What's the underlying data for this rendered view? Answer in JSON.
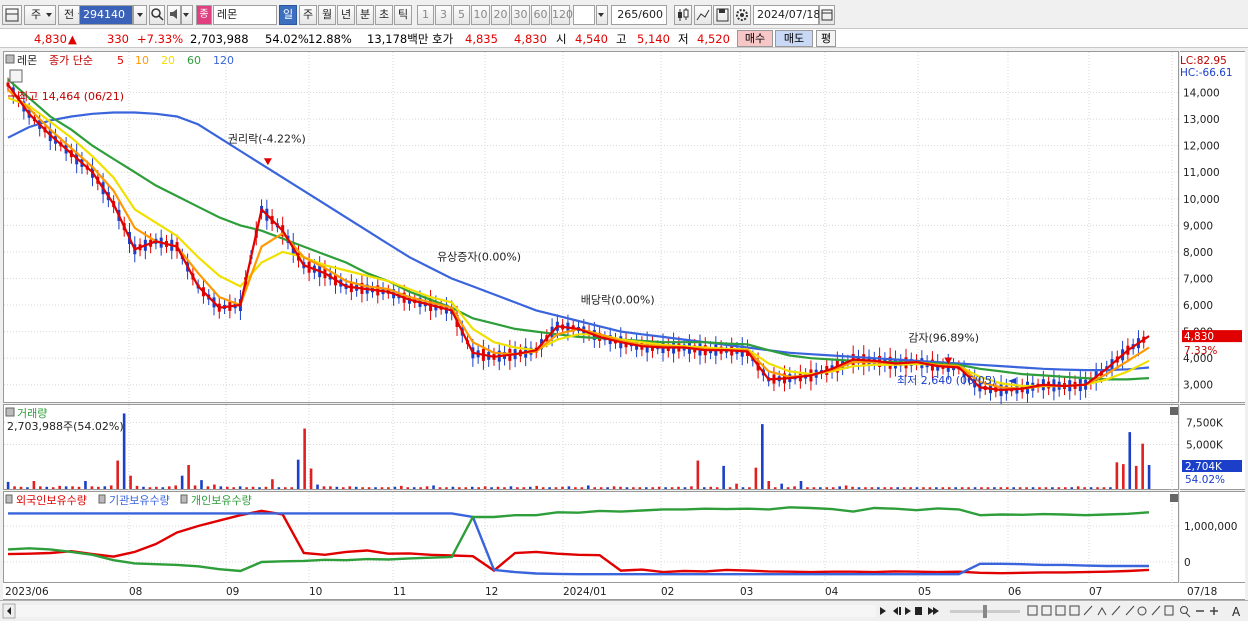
{
  "toolbar": {
    "market": "주",
    "prev": "전",
    "code": "294140",
    "name": "레몬",
    "periods": [
      "일",
      "주",
      "월",
      "년",
      "분",
      "초",
      "틱"
    ],
    "intervals": [
      "1",
      "3",
      "5",
      "10",
      "20",
      "30",
      "60",
      "120"
    ],
    "count": "265",
    "count_max": "/600",
    "date": "2024/07/18"
  },
  "quote": {
    "price": "4,830",
    "change": "330",
    "change_pct": "+7.33%",
    "volume": "2,703,988",
    "vol_ratio": "54.02%",
    "turnover": "12.88%",
    "amount": "13,178백만",
    "bid_label": "호가",
    "ask": "4,835",
    "bid": "4,830",
    "open_label": "시",
    "open": "4,540",
    "high_label": "고",
    "high": "5,140",
    "low_label": "저",
    "low": "4,520",
    "buy_btn": "매수",
    "sell_btn": "매도",
    "eval_btn": "평"
  },
  "price_panel": {
    "name": "레몬",
    "legend_prefix": "종가 단순",
    "ma_labels": [
      "5",
      "10",
      "20",
      "60",
      "120"
    ],
    "ma_colors": [
      "#e00000",
      "#ff9900",
      "#f0e000",
      "#2e9e3a",
      "#3a64dc"
    ],
    "lc": "LC:82.95",
    "hc": "HC:-66.61",
    "cur_price": "4,830",
    "cur_pct": "7.33%",
    "high_note": "최고 14,464 (06/21)",
    "low_note": "최저 2,640 (06/05)",
    "events": [
      "권리락(-4.22%)",
      "유상증자(0.00%)",
      "배당락(0.00%)",
      "감자(96.89%)"
    ]
  },
  "volume_panel": {
    "title": "거래량",
    "value": "2,703,988주(54.02%)",
    "cur": "2,704K",
    "cur_pct": "54.02%"
  },
  "holding_panel": {
    "series": [
      "외국인보유수량",
      "기관보유수량",
      "개인보유수량"
    ],
    "colors": [
      "#e00000",
      "#3a64dc",
      "#2e9e3a"
    ]
  },
  "x_labels": [
    "2023/06",
    "08",
    "09",
    "10",
    "11",
    "12",
    "2024/01",
    "02",
    "03",
    "04",
    "05",
    "06",
    "07",
    "07/18"
  ],
  "chart_data": [
    {
      "type": "line",
      "title": "",
      "y_ticks": [
        "14,000",
        "13,000",
        "12,000",
        "11,000",
        "10,000",
        "9,000",
        "8,000",
        "7,000",
        "6,000",
        "5,000",
        "4,000",
        "3,000"
      ],
      "ylim": [
        2500,
        15000
      ],
      "series": [
        {
          "name": "5",
          "values": [
            14300,
            13200,
            12400,
            11700,
            11000,
            9800,
            8100,
            8400,
            8200,
            6700,
            5900,
            6000,
            9600,
            8800,
            7500,
            7200,
            6700,
            6600,
            6500,
            6200,
            6000,
            5800,
            4200,
            4050,
            4150,
            4300,
            5200,
            5100,
            4800,
            4600,
            4450,
            4400,
            4400,
            4300,
            4300,
            4250,
            3200,
            3250,
            3350,
            3600,
            3950,
            3900,
            3800,
            3850,
            3700,
            3650,
            2900,
            2800,
            2850,
            3000,
            2950,
            3000,
            3600,
            4300,
            4830
          ]
        },
        {
          "name": "10",
          "values": [
            14100,
            13400,
            12600,
            11900,
            11200,
            10300,
            8900,
            8400,
            8200,
            7200,
            6300,
            6000,
            8200,
            8700,
            7800,
            7400,
            6900,
            6700,
            6600,
            6300,
            6100,
            5900,
            4600,
            4200,
            4150,
            4250,
            4900,
            5100,
            4900,
            4650,
            4500,
            4450,
            4400,
            4350,
            4300,
            4300,
            3500,
            3300,
            3350,
            3550,
            3850,
            3850,
            3800,
            3850,
            3750,
            3700,
            3100,
            2900,
            2850,
            2950,
            2950,
            3000,
            3400,
            3900,
            4400
          ]
        },
        {
          "name": "20",
          "values": [
            13800,
            13500,
            12900,
            12300,
            11600,
            10800,
            9600,
            9100,
            8600,
            7800,
            7100,
            6700,
            7600,
            8000,
            7800,
            7500,
            7300,
            7100,
            6900,
            6600,
            6300,
            6100,
            5100,
            4600,
            4400,
            4300,
            4700,
            4900,
            4900,
            4700,
            4600,
            4500,
            4450,
            4400,
            4350,
            4330,
            3800,
            3500,
            3400,
            3500,
            3700,
            3750,
            3750,
            3780,
            3750,
            3700,
            3300,
            3050,
            2950,
            2950,
            2950,
            3000,
            3200,
            3500,
            3900
          ]
        },
        {
          "name": "60",
          "values": [
            14500,
            13800,
            13100,
            12600,
            12000,
            11500,
            11000,
            10500,
            10100,
            9700,
            9300,
            9000,
            8800,
            8500,
            8200,
            7900,
            7600,
            7200,
            6900,
            6500,
            6200,
            5900,
            5500,
            5300,
            5100,
            5000,
            4900,
            4800,
            4750,
            4700,
            4650,
            4600,
            4600,
            4600,
            4550,
            4520,
            4300,
            4100,
            4000,
            3950,
            3900,
            3870,
            3850,
            3830,
            3800,
            3750,
            3600,
            3500,
            3400,
            3350,
            3300,
            3250,
            3200,
            3200,
            3250
          ]
        },
        {
          "name": "120",
          "values": [
            12300,
            12700,
            12950,
            13100,
            13200,
            13250,
            13250,
            13200,
            13100,
            12800,
            12300,
            11800,
            11300,
            10800,
            10300,
            9800,
            9300,
            8800,
            8300,
            7800,
            7400,
            7000,
            6700,
            6400,
            6100,
            5800,
            5600,
            5400,
            5200,
            5000,
            4900,
            4800,
            4700,
            4600,
            4500,
            4400,
            4300,
            4200,
            4150,
            4100,
            4050,
            4000,
            3950,
            3900,
            3850,
            3800,
            3750,
            3700,
            3650,
            3600,
            3570,
            3550,
            3550,
            3580,
            3650
          ]
        }
      ]
    },
    {
      "type": "bar",
      "title": "거래량",
      "y_ticks": [
        "7,500K",
        "5,000K"
      ],
      "ylim": [
        0,
        9000
      ],
      "values": [
        800,
        300,
        250,
        200,
        900,
        300,
        250,
        200,
        350,
        300,
        300,
        250,
        900,
        300,
        250,
        300,
        400,
        3200,
        8500,
        1500,
        350,
        250,
        200,
        250,
        200,
        300,
        400,
        1500,
        2700,
        400,
        1000,
        300,
        500,
        300,
        250,
        200,
        300,
        200,
        250,
        200,
        250,
        1100,
        200,
        200,
        200,
        3300,
        6800,
        2300,
        500,
        300,
        300,
        250,
        200,
        300,
        250,
        200,
        200,
        200,
        200,
        200,
        250,
        350,
        200,
        200,
        200,
        300,
        400,
        200,
        200,
        250,
        200,
        200,
        250,
        200,
        300,
        200,
        250,
        200,
        300,
        200,
        200,
        250,
        350,
        200,
        200,
        200,
        250,
        300,
        200,
        200,
        400,
        200,
        200,
        200,
        300,
        250,
        200,
        200,
        200,
        200,
        200,
        250,
        200,
        200,
        250,
        200,
        300,
        3200,
        200,
        250,
        200,
        2600,
        200,
        600,
        200,
        200,
        2400,
        7300,
        900,
        200,
        600,
        200,
        300,
        900,
        200,
        200,
        200,
        200,
        200,
        300,
        400,
        250,
        200,
        200,
        200,
        200,
        200,
        200,
        200,
        200,
        200,
        200,
        200,
        200,
        200,
        200,
        200,
        200,
        200,
        200,
        200,
        200,
        200,
        200,
        200,
        200,
        200,
        200,
        200,
        200,
        200,
        200,
        200,
        200,
        200,
        200,
        300,
        200,
        200,
        200,
        200,
        200,
        3000,
        2800,
        6400,
        2600,
        5100,
        2700
      ]
    },
    {
      "type": "line",
      "title": "",
      "y_ticks": [
        "1,000,000",
        "0"
      ],
      "ylim": [
        -500000,
        1500000
      ],
      "series": [
        {
          "name": "외국인보유수량",
          "values": [
            220000,
            230000,
            250000,
            300000,
            220000,
            150000,
            280000,
            500000,
            820000,
            1000000,
            1150000,
            1300000,
            1420000,
            1320000,
            250000,
            200000,
            280000,
            320000,
            230000,
            240000,
            200000,
            180000,
            160000,
            -240000,
            250000,
            280000,
            230000,
            200000,
            190000,
            -240000,
            -210000,
            -280000,
            -250000,
            -260000,
            -220000,
            -240000,
            -260000,
            -270000,
            -280000,
            -270000,
            -270000,
            -280000,
            -260000,
            -270000,
            -280000,
            -270000,
            -300000,
            -310000,
            -300000,
            -290000,
            -290000,
            -280000,
            -270000,
            -250000,
            -220000
          ]
        },
        {
          "name": "기관보유수량",
          "values": [
            1350000,
            1350000,
            1350000,
            1350000,
            1350000,
            1350000,
            1350000,
            1350000,
            1350000,
            1350000,
            1350000,
            1350000,
            1350000,
            1350000,
            1350000,
            1350000,
            1350000,
            1350000,
            1350000,
            1350000,
            1350000,
            1350000,
            1250000,
            -220000,
            -280000,
            -320000,
            -330000,
            -340000,
            -340000,
            -340000,
            -340000,
            -340000,
            -340000,
            -340000,
            -340000,
            -340000,
            -340000,
            -340000,
            -340000,
            -340000,
            -340000,
            -340000,
            -340000,
            -340000,
            -340000,
            -340000,
            -50000,
            -50000,
            -60000,
            -80000,
            -80000,
            -100000,
            -110000,
            -110000,
            -110000
          ]
        },
        {
          "name": "개인보유수량",
          "values": [
            350000,
            380000,
            350000,
            280000,
            200000,
            50000,
            -40000,
            -60000,
            -80000,
            -120000,
            -200000,
            -250000,
            0,
            20000,
            30000,
            60000,
            50000,
            80000,
            70000,
            100000,
            120000,
            140000,
            1250000,
            1250000,
            1300000,
            1300000,
            1380000,
            1370000,
            1420000,
            1400000,
            1430000,
            1460000,
            1460000,
            1480000,
            1470000,
            1480000,
            1460000,
            1520000,
            1500000,
            1470000,
            1400000,
            1500000,
            1480000,
            1440000,
            1490000,
            1460000,
            1300000,
            1320000,
            1310000,
            1330000,
            1320000,
            1300000,
            1320000,
            1340000,
            1380000
          ]
        }
      ]
    }
  ]
}
